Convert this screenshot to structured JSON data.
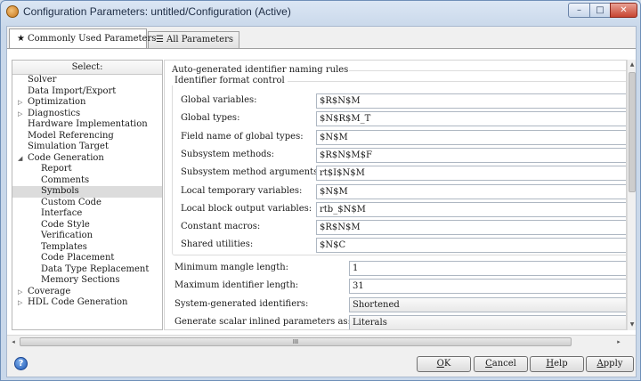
{
  "window": {
    "title": "Configuration Parameters: untitled/Configuration (Active)",
    "minimize_glyph": "–",
    "maximize_glyph": "□",
    "close_glyph": "✕"
  },
  "tabs": [
    {
      "label": "Commonly Used Parameters",
      "glyph": "★",
      "active": true
    },
    {
      "label": "All Parameters",
      "glyph": "☰",
      "active": false
    }
  ],
  "tree": {
    "header": "Select:",
    "items": [
      {
        "label": "Solver",
        "level": 0,
        "expander": ""
      },
      {
        "label": "Data Import/Export",
        "level": 0,
        "expander": ""
      },
      {
        "label": "Optimization",
        "level": 0,
        "expander": "▷"
      },
      {
        "label": "Diagnostics",
        "level": 0,
        "expander": "▷"
      },
      {
        "label": "Hardware Implementation",
        "level": 0,
        "expander": ""
      },
      {
        "label": "Model Referencing",
        "level": 0,
        "expander": ""
      },
      {
        "label": "Simulation Target",
        "level": 0,
        "expander": ""
      },
      {
        "label": "Code Generation",
        "level": 0,
        "expander": "◢"
      },
      {
        "label": "Report",
        "level": 1,
        "expander": ""
      },
      {
        "label": "Comments",
        "level": 1,
        "expander": ""
      },
      {
        "label": "Symbols",
        "level": 1,
        "expander": "",
        "selected": true
      },
      {
        "label": "Custom Code",
        "level": 1,
        "expander": ""
      },
      {
        "label": "Interface",
        "level": 1,
        "expander": ""
      },
      {
        "label": "Code Style",
        "level": 1,
        "expander": ""
      },
      {
        "label": "Verification",
        "level": 1,
        "expander": ""
      },
      {
        "label": "Templates",
        "level": 1,
        "expander": ""
      },
      {
        "label": "Code Placement",
        "level": 1,
        "expander": ""
      },
      {
        "label": "Data Type Replacement",
        "level": 1,
        "expander": ""
      },
      {
        "label": "Memory Sections",
        "level": 1,
        "expander": ""
      },
      {
        "label": "Coverage",
        "level": 0,
        "expander": "▷"
      },
      {
        "label": "HDL Code Generation",
        "level": 0,
        "expander": "▷"
      }
    ]
  },
  "content": {
    "section_title": "Auto-generated identifier naming rules",
    "group_title": "Identifier format control",
    "format_fields": [
      {
        "label": "Global variables:",
        "value": "$R$N$M"
      },
      {
        "label": "Global types:",
        "value": "$N$R$M_T"
      },
      {
        "label": "Field name of global types:",
        "value": "$N$M"
      },
      {
        "label": "Subsystem methods:",
        "value": "$R$N$M$F"
      },
      {
        "label": "Subsystem method arguments:",
        "value": "rt$I$N$M"
      },
      {
        "label": "Local temporary variables:",
        "value": "$N$M"
      },
      {
        "label": "Local block output variables:",
        "value": "rtb_$N$M"
      },
      {
        "label": "Constant macros:",
        "value": "$R$N$M"
      },
      {
        "label": "Shared utilities:",
        "value": "$N$C"
      }
    ],
    "other_fields": [
      {
        "label": "Minimum mangle length:",
        "value": "1",
        "kind": "input"
      },
      {
        "label": "Maximum identifier length:",
        "value": "31",
        "kind": "input"
      },
      {
        "label": "System-generated identifiers:",
        "value": "Shortened",
        "kind": "select"
      },
      {
        "label": "Generate scalar inlined parameters as:",
        "value": "Literals",
        "kind": "select"
      }
    ]
  },
  "scrollbar": {
    "thumb_grip": "III",
    "left_arrow": "◂",
    "right_arrow": "▸",
    "up_arrow": "▲",
    "down_arrow": "▼"
  },
  "buttons": {
    "help_icon_glyph": "?",
    "ok": {
      "mnemonic": "O",
      "rest": "K"
    },
    "cancel": {
      "mnemonic": "C",
      "rest": "ancel"
    },
    "help": {
      "mnemonic": "H",
      "rest": "elp"
    },
    "apply": {
      "mnemonic": "A",
      "rest": "pply"
    }
  }
}
